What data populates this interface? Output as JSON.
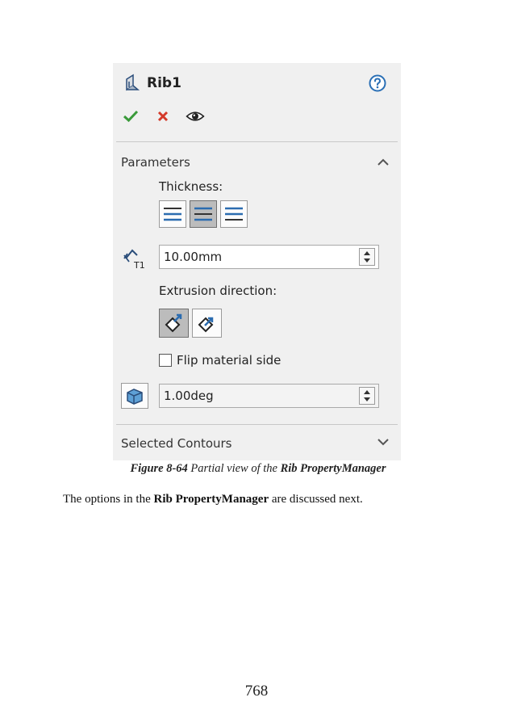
{
  "panel": {
    "title": "Rib1",
    "parameters_label": "Parameters",
    "thickness_label": "Thickness:",
    "thickness_value": "10.00mm",
    "extrusion_label": "Extrusion direction:",
    "flip_label": "Flip material side",
    "flip_checked": false,
    "draft_value": "1.00deg",
    "selected_contours_label": "Selected Contours"
  },
  "caption": {
    "figure_number": "Figure 8-64",
    "text": " Partial view of the ",
    "target": "Rib PropertyManager"
  },
  "body": {
    "prefix": "The options in the ",
    "bold": "Rib PropertyManager",
    "suffix": " are discussed next."
  },
  "page_number": "768",
  "colors": {
    "check": "#3a9a3a",
    "cancel": "#d43a2a",
    "accent_blue": "#2b6cb0"
  }
}
